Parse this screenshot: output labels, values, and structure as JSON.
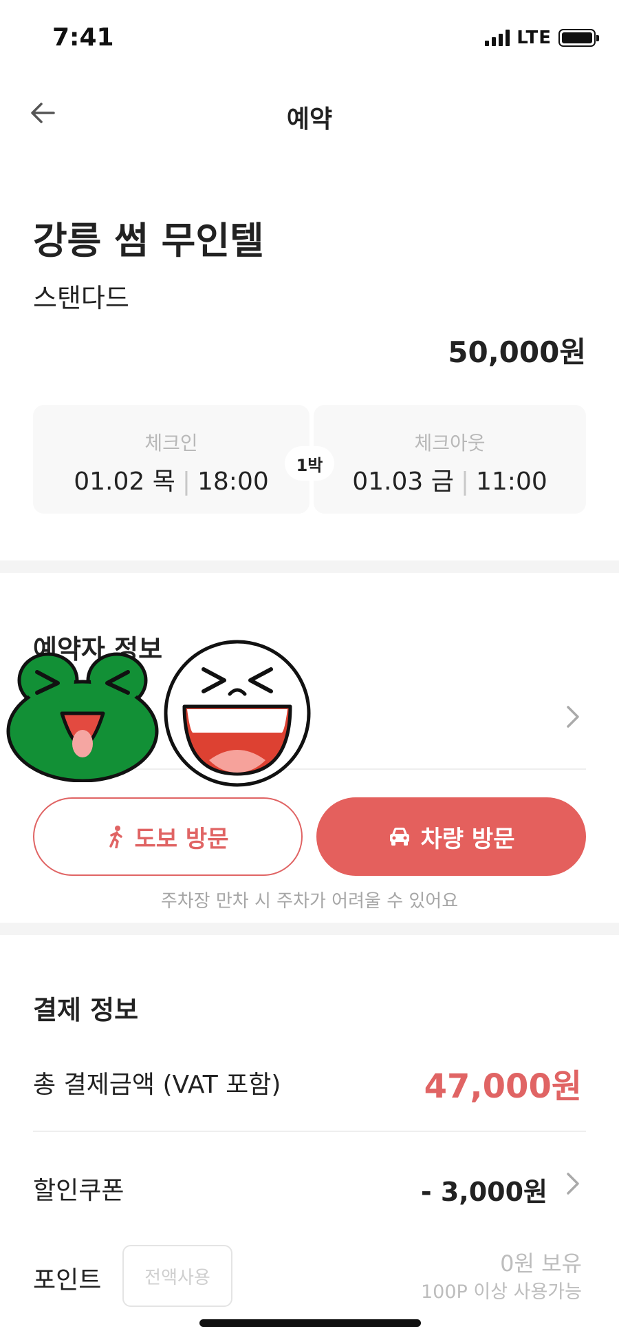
{
  "status_bar": {
    "time": "7:41",
    "network": "LTE"
  },
  "nav": {
    "title": "예약",
    "back_icon": "arrow-left-icon"
  },
  "hotel": {
    "name": "강릉 썸 무인텔",
    "room_type": "스탠다드",
    "price": "50,000원"
  },
  "stay": {
    "checkin_label": "체크인",
    "checkin_date": "01.02 목",
    "checkin_time": "18:00",
    "checkout_label": "체크아웃",
    "checkout_date": "01.03 금",
    "checkout_time": "11:00",
    "nights": "1박"
  },
  "reserver": {
    "title": "예약자 정보",
    "chevron_icon": "chevron-right-icon",
    "walk_label": "도보 방문",
    "walk_icon": "walking-person-icon",
    "car_label": "차량 방문",
    "car_icon": "car-icon",
    "parking_note": "주차장 만차 시 주차가 어려울 수 있어요"
  },
  "payment": {
    "title": "결제 정보",
    "total_label": "총 결제금액 (VAT 포함)",
    "total_amount": "47,000원",
    "coupon_label": "할인쿠폰",
    "coupon_amount": "- 3,000원",
    "points_label": "포인트",
    "points_use_all": "전액사용",
    "points_held": "0원 보유",
    "points_min": "100P 이상 사용가능"
  },
  "stickers": [
    "laughing-frog-sticker",
    "laughing-face-sticker"
  ],
  "colors": {
    "accent": "#e4605d",
    "muted": "#b8b8b8",
    "divider": "#f4f4f4"
  }
}
